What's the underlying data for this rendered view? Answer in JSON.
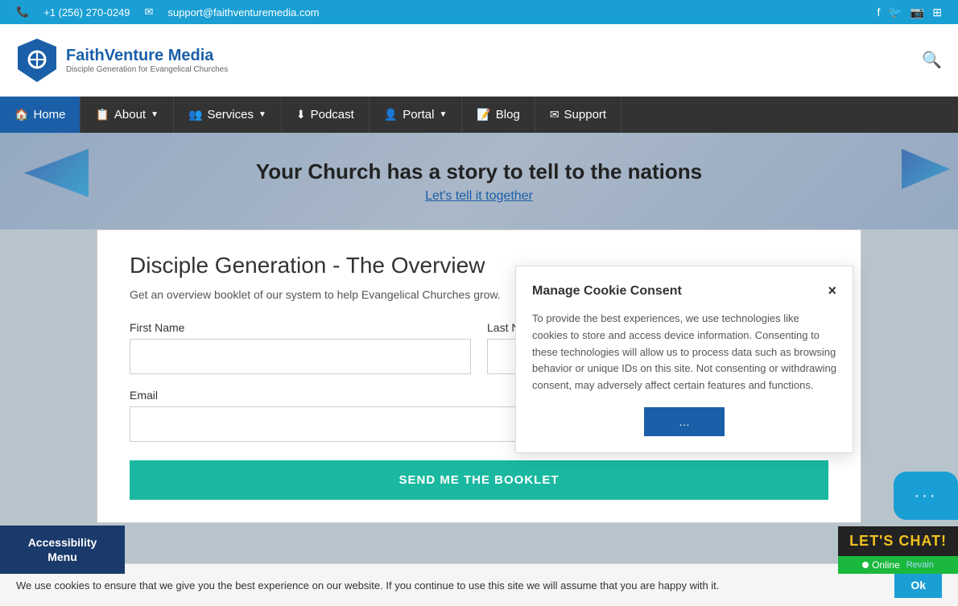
{
  "topbar": {
    "phone": "+1 (256) 270-0249",
    "email": "support@faithventuremedia.com",
    "icons": [
      "facebook",
      "twitter",
      "instagram",
      "rss"
    ]
  },
  "logo": {
    "name": "FaithVenture Media",
    "tagline": "Disciple Generation for Evangelical Churches"
  },
  "nav": {
    "items": [
      {
        "label": "Home",
        "icon": "🏠",
        "active": true
      },
      {
        "label": "About",
        "icon": "📋",
        "has_arrow": true
      },
      {
        "label": "Services",
        "icon": "👥",
        "has_arrow": true
      },
      {
        "label": "Podcast",
        "icon": "⬇",
        "has_arrow": false
      },
      {
        "label": "Portal",
        "icon": "👤",
        "has_arrow": true
      },
      {
        "label": "Blog",
        "icon": "📝",
        "has_arrow": false
      },
      {
        "label": "Support",
        "icon": "✉",
        "has_arrow": false
      }
    ]
  },
  "hero": {
    "title": "Your Church has a story to tell to the nations",
    "link": "Let's tell it together"
  },
  "form": {
    "title": "Disciple Generation - The Overview",
    "description": "Get an overview booklet of our system to help Evangelical Churches grow.",
    "first_name_label": "First Name",
    "last_name_label": "Last Name",
    "email_label": "Email",
    "button_label": "SEND ME THE BOOKLET"
  },
  "cookie_modal": {
    "title": "Manage Cookie Consent",
    "text": "To provide the best experiences, we use technologies like cookies to store and access device information. Consenting to these technologies will allow us to process data such as browsing behavior or unique IDs on this site. Not consenting or withdrawing consent, may adversely affect certain features and functions.",
    "button_label": "…",
    "close_icon": "×"
  },
  "cookie_bar": {
    "text": "We use cookies to ensure that we give you the best experience on our website. If you continue to use this site we will assume that you are happy with it.",
    "ok_label": "Ok"
  },
  "accessibility": {
    "label": "Accessibility\nMenu"
  },
  "chat": {
    "label": "LET'S CHAT!",
    "status": "Online",
    "brand": "Revain"
  }
}
